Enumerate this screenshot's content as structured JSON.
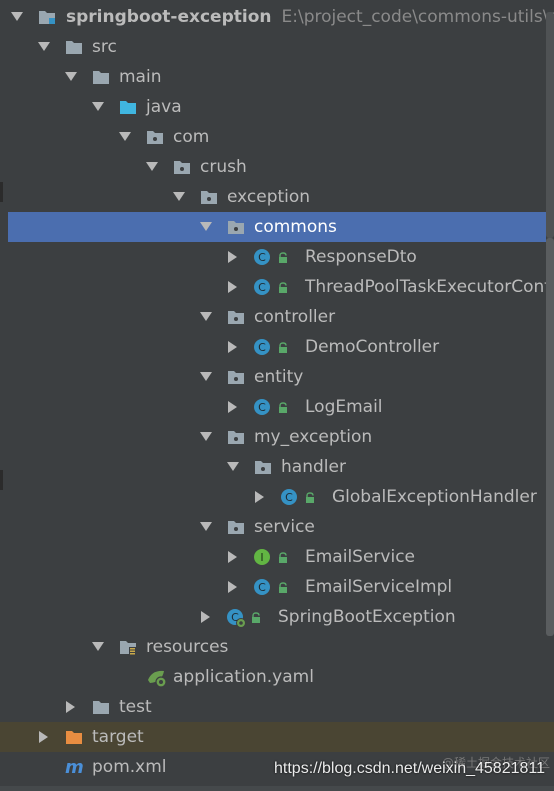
{
  "project": {
    "name": "springboot-exception",
    "path": "E:\\project_code\\commons-utils\\s"
  },
  "rows": [
    {
      "id": "src",
      "label": "src",
      "level": 1,
      "arrow": "down",
      "icon": "folder"
    },
    {
      "id": "main",
      "label": "main",
      "level": 2,
      "arrow": "down",
      "icon": "folder"
    },
    {
      "id": "java",
      "label": "java",
      "level": 3,
      "arrow": "down",
      "icon": "folder-src"
    },
    {
      "id": "com",
      "label": "com",
      "level": 4,
      "arrow": "down",
      "icon": "package"
    },
    {
      "id": "crush",
      "label": "crush",
      "level": 5,
      "arrow": "down",
      "icon": "package"
    },
    {
      "id": "exception",
      "label": "exception",
      "level": 6,
      "arrow": "down",
      "icon": "package"
    },
    {
      "id": "commons",
      "label": "commons",
      "level": 7,
      "arrow": "down",
      "icon": "package",
      "selected": true
    },
    {
      "id": "responsedto",
      "label": "ResponseDto",
      "level": 8,
      "arrow": "right",
      "icon": "class"
    },
    {
      "id": "threadpool",
      "label": "ThreadPoolTaskExecutorConf",
      "level": 8,
      "arrow": "right",
      "icon": "class"
    },
    {
      "id": "controller",
      "label": "controller",
      "level": 7,
      "arrow": "down",
      "icon": "package"
    },
    {
      "id": "democontroller",
      "label": "DemoController",
      "level": 8,
      "arrow": "right",
      "icon": "class"
    },
    {
      "id": "entity",
      "label": "entity",
      "level": 7,
      "arrow": "down",
      "icon": "package"
    },
    {
      "id": "logemail",
      "label": "LogEmail",
      "level": 8,
      "arrow": "right",
      "icon": "class"
    },
    {
      "id": "my_exception",
      "label": "my_exception",
      "level": 7,
      "arrow": "down",
      "icon": "package"
    },
    {
      "id": "handler",
      "label": "handler",
      "level": 8,
      "arrow": "down",
      "icon": "package"
    },
    {
      "id": "globalexceptionhandler",
      "label": "GlobalExceptionHandler",
      "level": 9,
      "arrow": "right",
      "icon": "class"
    },
    {
      "id": "service",
      "label": "service",
      "level": 7,
      "arrow": "down",
      "icon": "package"
    },
    {
      "id": "emailservice",
      "label": "EmailService",
      "level": 8,
      "arrow": "right",
      "icon": "interface"
    },
    {
      "id": "emailserviceimpl",
      "label": "EmailServiceImpl",
      "level": 8,
      "arrow": "right",
      "icon": "class"
    },
    {
      "id": "springbootexception",
      "label": "SpringBootException",
      "level": 7,
      "arrow": "right",
      "icon": "spring-class"
    },
    {
      "id": "resources",
      "label": "resources",
      "level": 3,
      "arrow": "down",
      "icon": "folder-res"
    },
    {
      "id": "applicationyaml",
      "label": "application.yaml",
      "level": 4,
      "arrow": "none",
      "icon": "yaml"
    },
    {
      "id": "test",
      "label": "test",
      "level": 2,
      "arrow": "right",
      "icon": "folder"
    },
    {
      "id": "target",
      "label": "target",
      "level": 1,
      "arrow": "right",
      "icon": "folder-excluded",
      "highlight": true
    },
    {
      "id": "pomxml",
      "label": "pom.xml",
      "level": 1,
      "arrow": "none",
      "icon": "maven"
    }
  ],
  "watermark": "https://blog.csdn.net/weixin_45821811",
  "watermark_faint": "@稀土掘金技术社区",
  "colors": {
    "background": "#3c3f41",
    "selection": "#4b6eaf",
    "class_icon": "#3592c4",
    "interface_icon": "#62b543",
    "lock_icon": "#59a869",
    "folder": "#9aa7b0",
    "folder_src": "#40b6e0",
    "folder_excluded": "#e88d41"
  }
}
